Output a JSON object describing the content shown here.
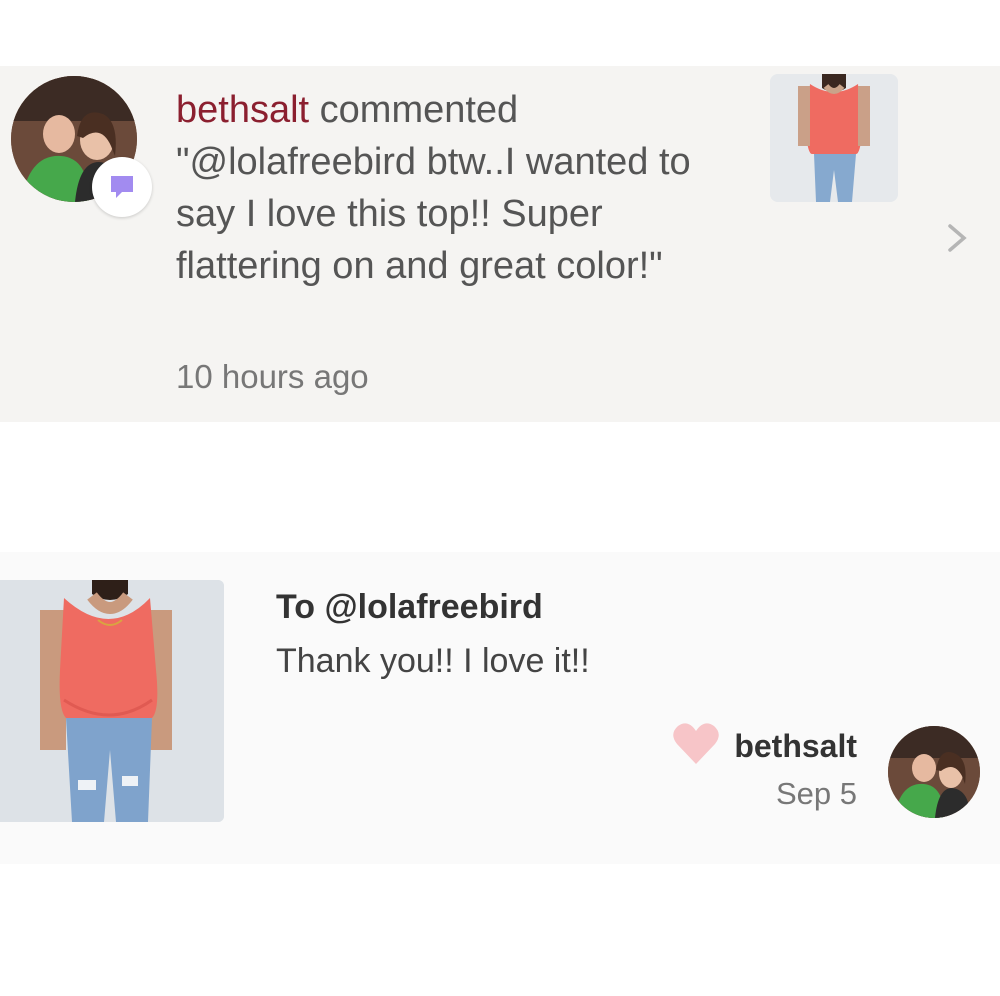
{
  "notification": {
    "username": "bethsalt",
    "action": " commented",
    "comment": "\"@lolafreebird btw..I wanted to say I love this top!! Super flattering on and great color!\"",
    "time": "10 hours ago",
    "badge_icon": "comment-bubble-icon",
    "badge_color": "#a28bf0"
  },
  "reply": {
    "to_prefix": "To ",
    "to_handle": "@lolafreebird",
    "message": "Thank you!! I love it!!",
    "username": "bethsalt",
    "date": "Sep 5",
    "like_icon": "heart-icon",
    "like_color": "#f7c5c8"
  },
  "colors": {
    "username_accent": "#8b1f2f",
    "top_color": "#ef6b61"
  }
}
